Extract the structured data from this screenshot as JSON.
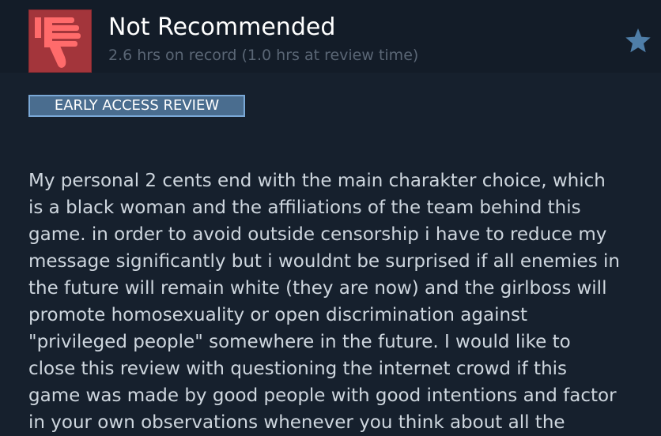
{
  "review": {
    "verdict": "Not Recommended",
    "hours": "2.6 hrs on record (1.0 hrs at review time)",
    "badge": "EARLY ACCESS REVIEW",
    "lines": [
      "My personal 2 cents end with the main charakter choice, which",
      "is a black woman and the affiliations of the team behind this",
      "game. in order to avoid outside censorship i have to reduce my",
      "message significantly but i wouldnt be surprised if all enemies in",
      "the future will remain white (they are now) and the girlboss will",
      "promote homosexuality or open discrimination against",
      "\"privileged people\" somewhere in the future. I would like to",
      "close this review with questioning the internet crowd if this",
      "game was made by good people with good intentions and factor",
      "in your own observations whenever you think about all the"
    ]
  },
  "icons": {
    "verdict_icon": "thumbs-down-icon",
    "action_icon": "star-icon"
  },
  "colors": {
    "background": "#16202d",
    "header_background": "#131c28",
    "thumb_box": "#a3353b",
    "thumb_icon": "#ff6b6b",
    "star": "#4f7ea8",
    "badge_background": "#4a6d8f",
    "badge_border": "#7aa8d6",
    "text": "#ced6de",
    "muted_text": "#5a6675"
  }
}
